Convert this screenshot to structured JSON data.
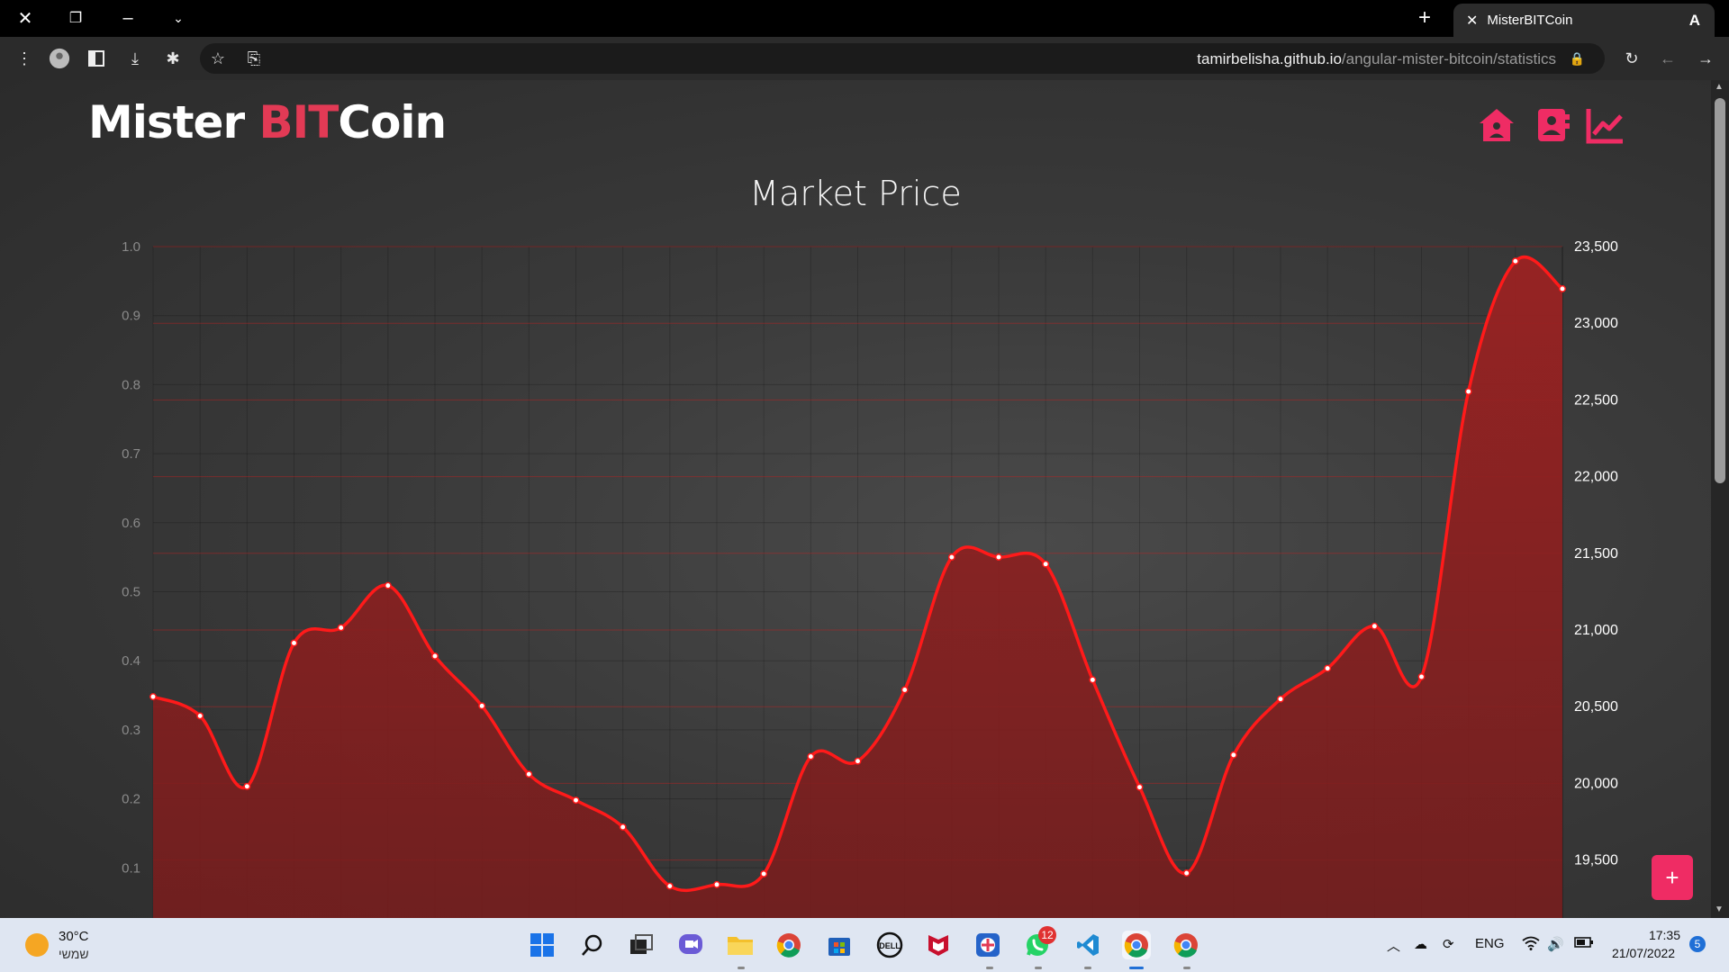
{
  "browser": {
    "tab_title": "MisterBITCoin",
    "profile_initial": "A",
    "url_host": "tamirbelisha.github.io",
    "url_path": "/angular-mister-bitcoin/statistics"
  },
  "header": {
    "logo_part1": "Mister ",
    "logo_part2": "BIT",
    "logo_part3": "Coin",
    "nav": [
      "home-icon",
      "contacts-icon",
      "statistics-icon"
    ],
    "accent_color": "#ef2c64"
  },
  "main": {
    "title": "Market Price",
    "add_label": "+"
  },
  "chart_data": {
    "type": "area",
    "title": "Market Price",
    "line_color": "#ff1a1a",
    "fill_color": "#8a1f1f",
    "left_axis": {
      "ticks": [
        "0.1",
        "0.2",
        "0.3",
        "0.4",
        "0.5",
        "0.6",
        "0.7",
        "0.8",
        "0.9",
        "1.0"
      ],
      "ylim": [
        0,
        1
      ]
    },
    "right_axis": {
      "ticks": [
        "19,500",
        "20,000",
        "20,500",
        "21,000",
        "21,500",
        "22,000",
        "22,500",
        "23,000",
        "23,500"
      ],
      "ylim": [
        19150,
        23500
      ]
    },
    "grid": true,
    "values": [
      20565,
      20440,
      19980,
      20915,
      21015,
      21290,
      20830,
      20505,
      20060,
      19890,
      19715,
      19330,
      19340,
      19410,
      20175,
      20145,
      20610,
      21475,
      21475,
      21430,
      20675,
      19975,
      19415,
      20185,
      20550,
      20750,
      21025,
      20695,
      22555,
      23405,
      23225
    ]
  },
  "taskbar": {
    "weather_temp": "30°C",
    "weather_desc": "שמשי",
    "whatsapp_badge": "12",
    "language": "ENG",
    "time": "17:35",
    "date": "21/07/2022",
    "notifications": "5"
  }
}
